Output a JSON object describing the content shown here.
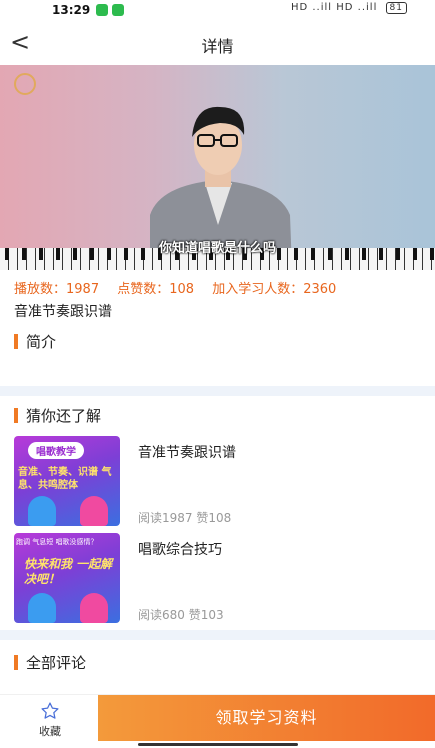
{
  "status_bar": {
    "time": "13:29",
    "right_text": "HD ..ill HD ..ill",
    "battery": "81"
  },
  "nav": {
    "back_symbol": "<",
    "title": "详情"
  },
  "video": {
    "subtitle": "你知道唱歌是什么吗"
  },
  "stats": {
    "plays": "播放数：1987",
    "likes": "点赞数：108",
    "learners": "加入学习人数：2360"
  },
  "video_title": "音准节奏跟识谱",
  "sections": {
    "intro": "简介",
    "guess": "猜你还了解",
    "comments": "全部评论"
  },
  "cards": [
    {
      "title": "音准节奏跟识谱",
      "meta": "阅读1987  赞108",
      "thumb_badge": "唱歌教学",
      "thumb_text": "音准、节奏、识谱 气息、共鸣腔体"
    },
    {
      "title": "唱歌综合技巧",
      "meta": "阅读680  赞103",
      "thumb_top": "跑调 气息短 唱歌没感情？",
      "thumb_text": "快来和我 一起解决吧！"
    }
  ],
  "bottom": {
    "favorite": "收藏",
    "cta": "领取学习资料"
  },
  "colors": {
    "accent": "#f07a24",
    "stats": "#e8661e",
    "divider": "#eef3fa"
  }
}
